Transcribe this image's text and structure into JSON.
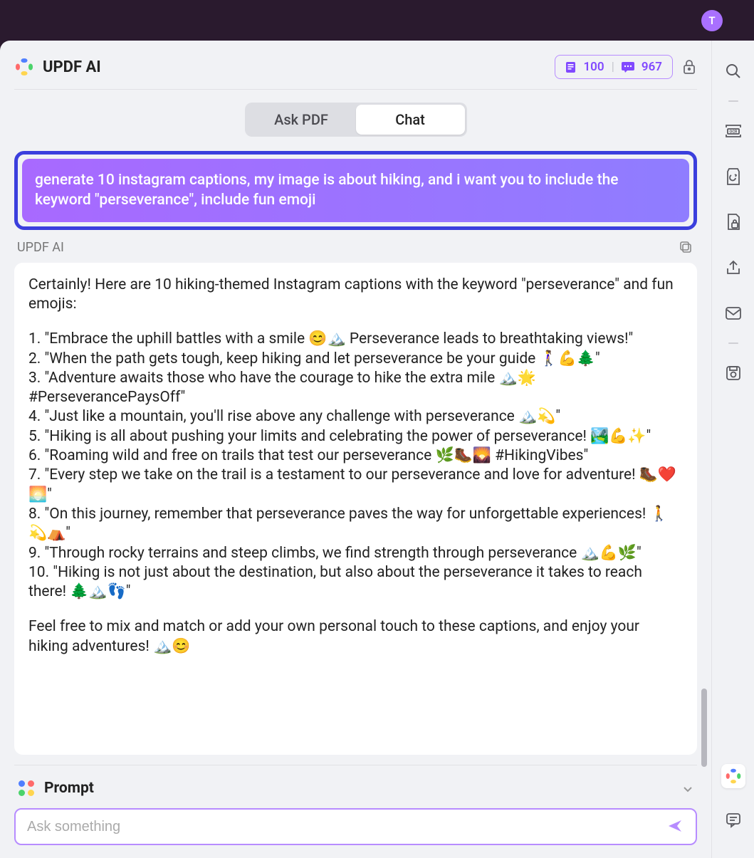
{
  "avatar_letter": "T",
  "header": {
    "title": "UPDF AI",
    "usage": {
      "pages": "100",
      "tokens": "967"
    }
  },
  "tabs": {
    "ask_pdf": "Ask PDF",
    "chat": "Chat"
  },
  "user_message": "generate 10 instagram captions, my image is about hiking, and i want you to include the keyword \"perseverance\", include fun emoji",
  "response": {
    "sender": "UPDF AI",
    "intro": "Certainly! Here are 10 hiking-themed Instagram captions with the keyword \"perseverance\" and fun emojis:",
    "items": [
      "1. \"Embrace the uphill battles with a smile 😊🏔️ Perseverance leads to breathtaking views!\"",
      "2. \"When the path gets tough, keep hiking and let perseverance be your guide 🚶‍♀️💪🌲\"",
      "3. \"Adventure awaits those who have the courage to hike the extra mile 🏔️🌟 #PerseverancePaysOff\"",
      "4. \"Just like a mountain, you'll rise above any challenge with perseverance 🏔️💫\"",
      "5. \"Hiking is all about pushing your limits and celebrating the power of perseverance! 🏞️💪✨\"",
      "6. \"Roaming wild and free on trails that test our perseverance 🌿🥾🌄 #HikingVibes\"",
      "7. \"Every step we take on the trail is a testament to our perseverance and love for adventure! 🥾❤️🌅\"",
      "8. \"On this journey, remember that perseverance paves the way for unforgettable experiences! 🚶💫⛺\"",
      "9. \"Through rocky terrains and steep climbs, we find strength through perseverance 🏔️💪🌿\"",
      "10. \"Hiking is not just about the destination, but also about the perseverance it takes to reach there! 🌲🏔️👣\""
    ],
    "outro": "Feel free to mix and match or add your own personal touch to these captions, and enjoy your hiking adventures! 🏔️😊"
  },
  "bottom": {
    "prompt_label": "Prompt",
    "input_placeholder": "Ask something"
  }
}
